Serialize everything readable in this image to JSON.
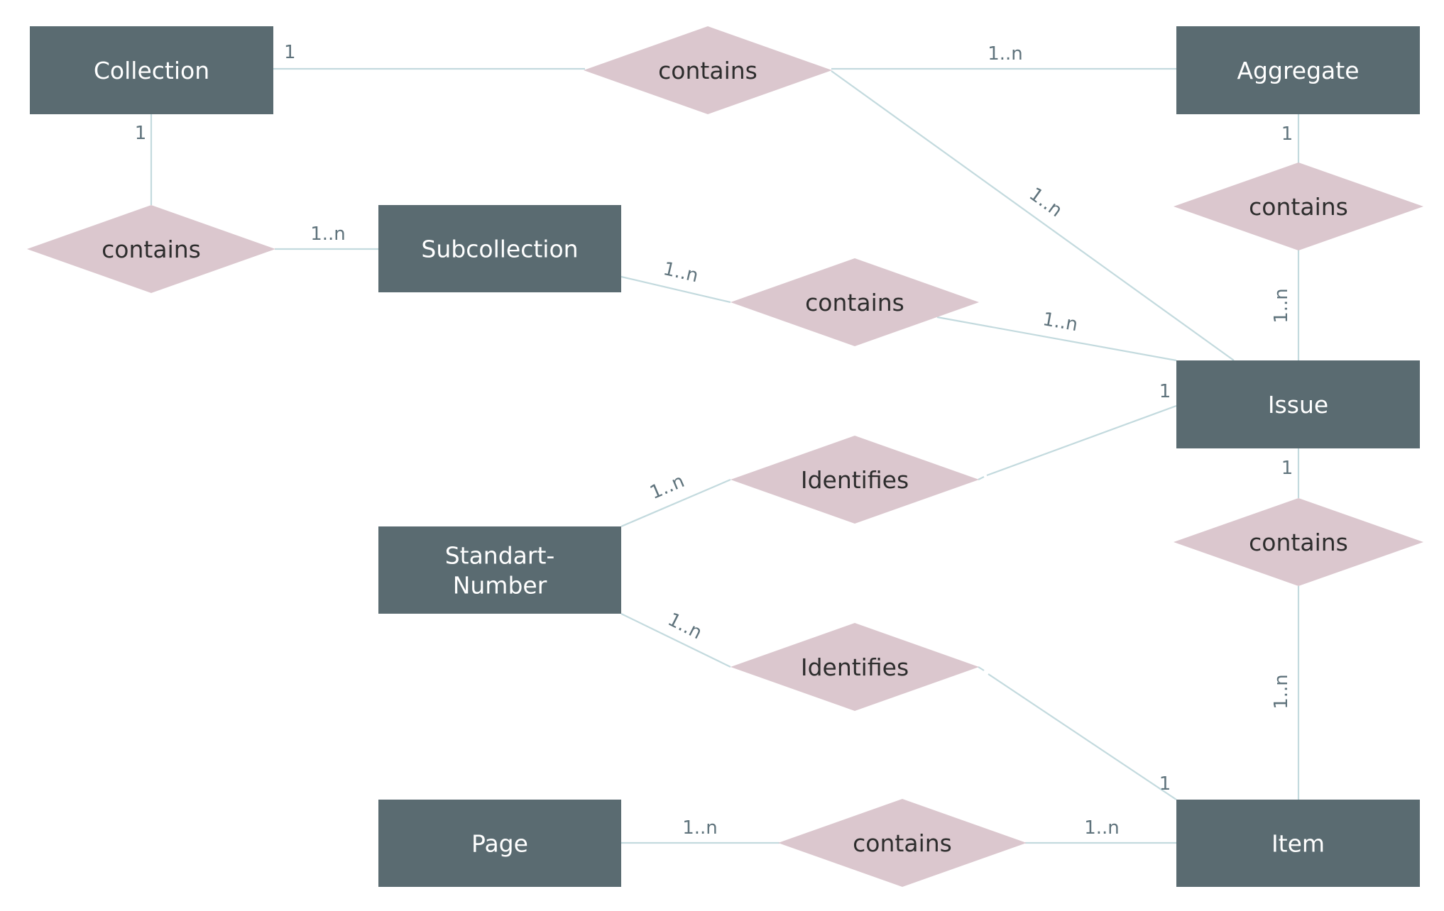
{
  "diagram": {
    "type": "entity-relationship",
    "colors": {
      "entity_fill": "#5a6b71",
      "entity_text": "#ffffff",
      "relationship_fill": "#dbc7ce",
      "relationship_text": "#2d2d2d",
      "connector": "#c3dade",
      "cardinality_text": "#5f737c"
    },
    "entities": [
      {
        "id": "collection",
        "label": [
          "Collection"
        ]
      },
      {
        "id": "aggregate",
        "label": [
          "Aggregate"
        ]
      },
      {
        "id": "subcollection",
        "label": [
          "Subcollection"
        ]
      },
      {
        "id": "issue",
        "label": [
          "Issue"
        ]
      },
      {
        "id": "standart-number",
        "label": [
          "Standart-",
          "Number"
        ]
      },
      {
        "id": "page",
        "label": [
          "Page"
        ]
      },
      {
        "id": "item",
        "label": [
          "Item"
        ]
      }
    ],
    "relationships": [
      {
        "id": "rel-collection-aggregate",
        "label": "contains"
      },
      {
        "id": "rel-collection-subcollection",
        "label": "contains"
      },
      {
        "id": "rel-aggregate-issue",
        "label": "contains"
      },
      {
        "id": "rel-subcollection-issue",
        "label": "contains"
      },
      {
        "id": "rel-standart-issue",
        "label": "Identifies"
      },
      {
        "id": "rel-issue-item",
        "label": "contains"
      },
      {
        "id": "rel-standart-item",
        "label": "Identifies"
      },
      {
        "id": "rel-page-item",
        "label": "contains"
      }
    ],
    "connections": [
      {
        "from": "collection",
        "to": "rel-collection-aggregate",
        "cardinality": "1"
      },
      {
        "from": "rel-collection-aggregate",
        "to": "aggregate",
        "cardinality": "1..n"
      },
      {
        "from": "rel-collection-aggregate",
        "to": "issue",
        "cardinality": "1..n"
      },
      {
        "from": "collection",
        "to": "rel-collection-subcollection",
        "cardinality": "1"
      },
      {
        "from": "rel-collection-subcollection",
        "to": "subcollection",
        "cardinality": "1..n"
      },
      {
        "from": "aggregate",
        "to": "rel-aggregate-issue",
        "cardinality": "1"
      },
      {
        "from": "rel-aggregate-issue",
        "to": "issue",
        "cardinality": "1..n"
      },
      {
        "from": "subcollection",
        "to": "rel-subcollection-issue",
        "cardinality": "1..n"
      },
      {
        "from": "rel-subcollection-issue",
        "to": "issue",
        "cardinality": "1..n"
      },
      {
        "from": "rel-standart-issue",
        "to": "issue",
        "cardinality": "1"
      },
      {
        "from": "standart-number",
        "to": "rel-standart-issue",
        "cardinality": "1..n"
      },
      {
        "from": "standart-number",
        "to": "rel-standart-item",
        "cardinality": "1..n"
      },
      {
        "from": "rel-standart-item",
        "to": "item",
        "cardinality": "1"
      },
      {
        "from": "issue",
        "to": "rel-issue-item",
        "cardinality": "1"
      },
      {
        "from": "rel-issue-item",
        "to": "item",
        "cardinality": "1..n"
      },
      {
        "from": "page",
        "to": "rel-page-item",
        "cardinality": "1..n"
      },
      {
        "from": "rel-page-item",
        "to": "item",
        "cardinality": "1..n"
      }
    ]
  }
}
